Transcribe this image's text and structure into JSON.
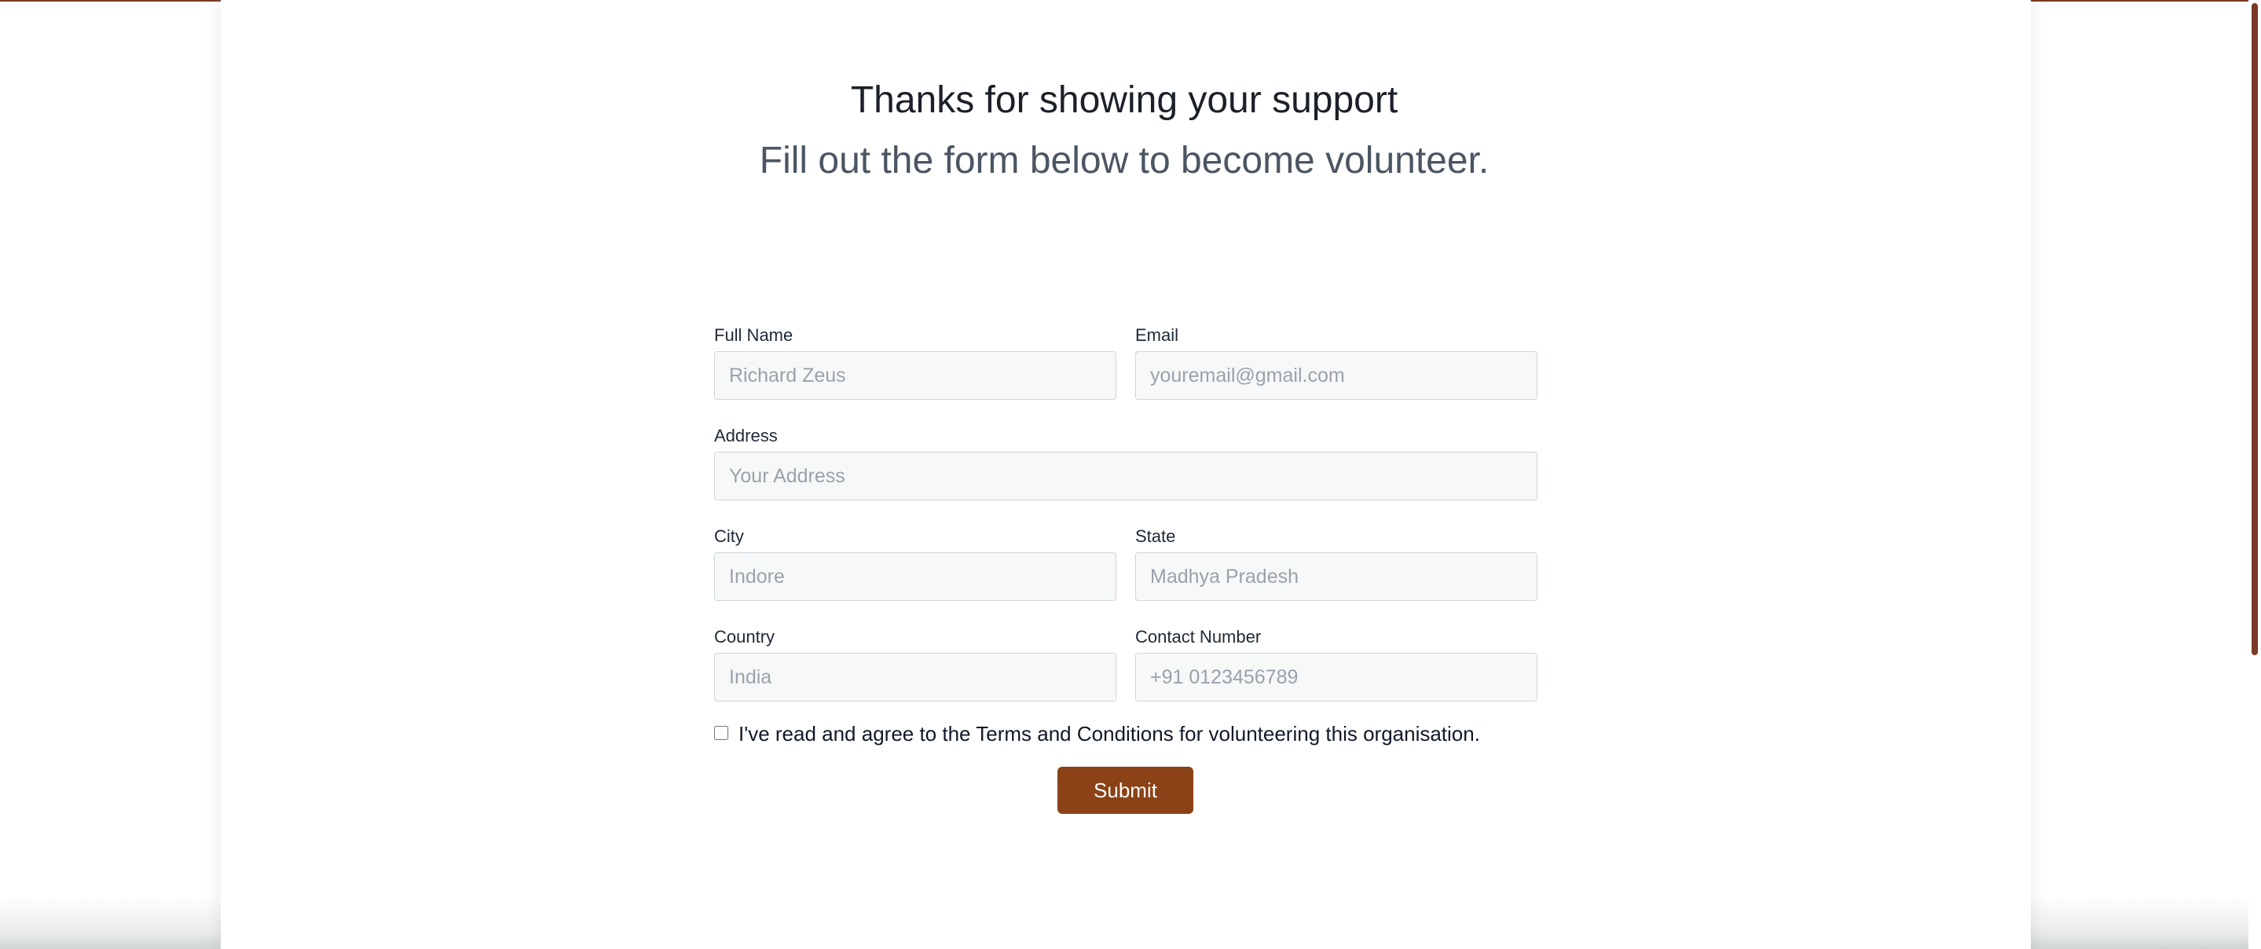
{
  "header": {
    "title": "Thanks for showing your support",
    "subtitle": "Fill out the form below to become volunteer."
  },
  "form": {
    "full_name": {
      "label": "Full Name",
      "placeholder": "Richard Zeus",
      "value": ""
    },
    "email": {
      "label": "Email",
      "placeholder": "youremail@gmail.com",
      "value": ""
    },
    "address": {
      "label": "Address",
      "placeholder": "Your Address",
      "value": ""
    },
    "city": {
      "label": "City",
      "placeholder": "Indore",
      "value": ""
    },
    "state": {
      "label": "State",
      "placeholder": "Madhya Pradesh",
      "value": ""
    },
    "country": {
      "label": "Country",
      "placeholder": "India",
      "value": ""
    },
    "contact": {
      "label": "Contact Number",
      "placeholder": "+91 0123456789",
      "value": ""
    },
    "terms": {
      "label": "I've read and agree to the Terms and Conditions for volunteering this organisation.",
      "checked": false
    },
    "submit_label": "Submit"
  },
  "colors": {
    "accent": "#8b4216",
    "scrollbar": "#7b3825"
  }
}
